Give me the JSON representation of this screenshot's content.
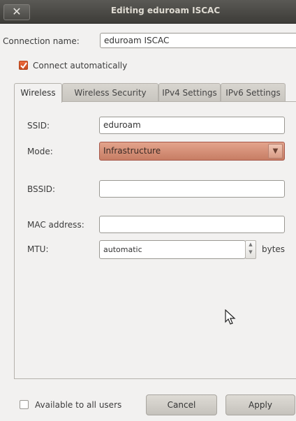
{
  "window": {
    "title": "Editing eduroam ISCAC",
    "close_glyph": "✕"
  },
  "connection": {
    "name_label": "Connection name:",
    "name_value": "eduroam ISCAC",
    "auto_connect_label": "Connect automatically",
    "auto_connect_checked": true
  },
  "tabs": [
    {
      "label": "Wireless",
      "active": true
    },
    {
      "label": "Wireless Security",
      "active": false
    },
    {
      "label": "IPv4 Settings",
      "active": false
    },
    {
      "label": "IPv6 Settings",
      "active": false
    }
  ],
  "wireless": {
    "ssid_label": "SSID:",
    "ssid_value": "eduroam",
    "mode_label": "Mode:",
    "mode_value": "Infrastructure",
    "bssid_label": "BSSID:",
    "bssid_value": "",
    "mac_label": "MAC address:",
    "mac_value": "",
    "mtu_label": "MTU:",
    "mtu_value": "automatic",
    "mtu_unit": "bytes"
  },
  "footer": {
    "available_label": "Available to all users",
    "available_checked": false,
    "cancel_label": "Cancel",
    "apply_label": "Apply"
  },
  "colors": {
    "accent": "#d9886b",
    "titlebar": "#3d3c38",
    "check": "#e0582a"
  },
  "icons": {
    "close": "close-icon",
    "dropdown": "chevron-down-icon",
    "spin": "spinner-arrows-icon",
    "cursor": "mouse-pointer-icon"
  }
}
